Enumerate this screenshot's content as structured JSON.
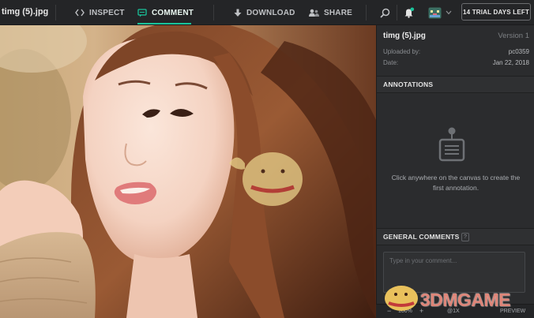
{
  "file": {
    "name": "timg (5).jpg"
  },
  "nav": {
    "inspect": "INSPECT",
    "comment": "COMMENT",
    "download": "DOWNLOAD",
    "share": "SHARE"
  },
  "trial_button": "14 TRIAL DAYS LEFT",
  "panel": {
    "file_name": "timg (5).jpg",
    "version": "Version 1",
    "uploaded_by_label": "Uploaded by:",
    "uploaded_by_value": "pc0359",
    "date_label": "Date:",
    "date_value": "Jan 22, 2018",
    "annotations_title": "ANNOTATIONS",
    "annotations_empty": "Click anywhere on the canvas to create the first annotation.",
    "general_comments_title": "GENERAL COMMENTS",
    "help_badge": "?",
    "comment_placeholder": "Type in your comment..."
  },
  "toolbar": {
    "zoom_out": "−",
    "zoom_level": "100%",
    "zoom_in": "+",
    "scale": "@1X",
    "preview": "PREVIEW"
  },
  "watermark": {
    "text": "3DMGAME"
  },
  "colors": {
    "accent": "#19c39a",
    "background": "#2b2c2e",
    "topbar": "#242527"
  },
  "icons": [
    "inspect-icon",
    "comment-icon",
    "download-icon",
    "share-icon",
    "search-icon",
    "notification-bell-icon",
    "avatar-icon",
    "annotation-icon"
  ]
}
